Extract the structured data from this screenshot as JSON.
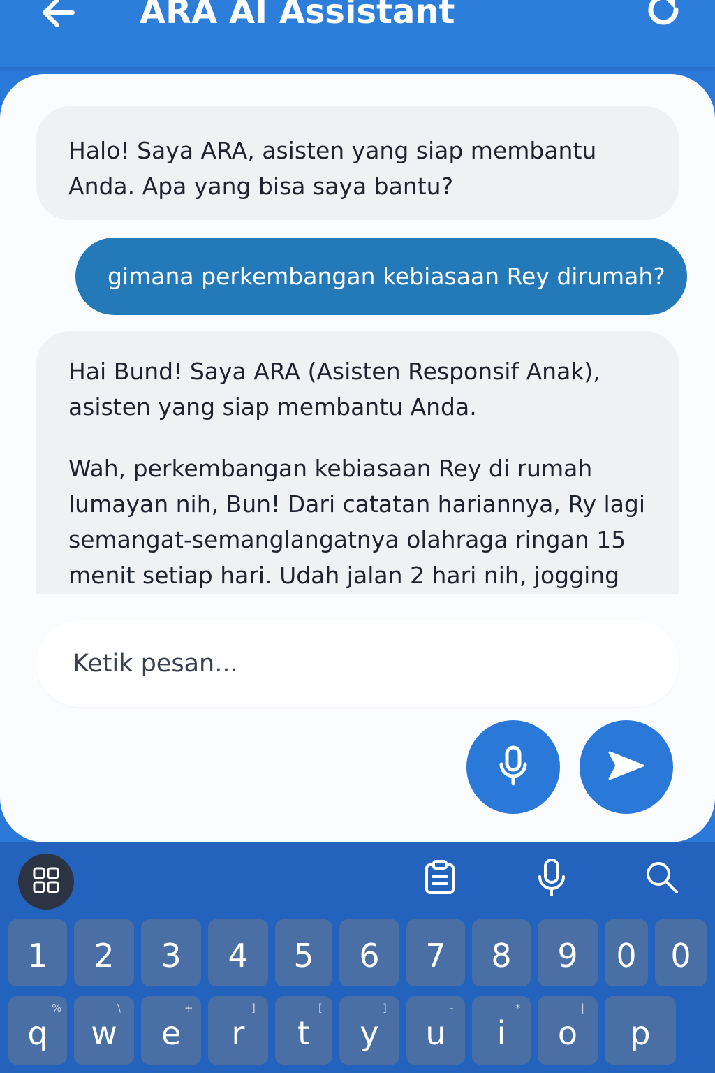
{
  "header": {
    "title": "ARA AI Assistant",
    "back_icon": "arrow-left-icon",
    "refresh_icon": "refresh-icon",
    "color": "#2d7ddb"
  },
  "messages": [
    {
      "role": "assistant",
      "paragraphs": [
        "Halo! Saya ARA, asisten yang siap membantu Anda. Apa yang bisa saya bantu?"
      ]
    },
    {
      "role": "user",
      "text": "gimana perkembangan kebiasaan Rey dirumah?",
      "color": "#2479b8"
    },
    {
      "role": "assistant",
      "paragraphs": [
        "Hai Bund! Saya ARA (Asisten Responsif Anak), asisten yang siap membantu Anda.",
        "Wah, perkembangan kebiasaan Rey di rumah lumayan nih, Bun! Dari catatan hariannya, Ry lagi semangat-semanglangatnya olahraga ringan 15 menit setiap hari. Udah jalan 2 hari nih, jogging"
      ]
    }
  ],
  "composer": {
    "placeholder": "Ketik pesan...",
    "mic_icon": "microphone-icon",
    "send_icon": "send-icon"
  },
  "keyboard": {
    "toolbar": [
      "apps-grid-icon",
      "clipboard-icon",
      "microphone-icon",
      "search-icon"
    ],
    "number_row": [
      "1",
      "2",
      "3",
      "4",
      "5",
      "6",
      "7",
      "8",
      "9",
      "0",
      "0"
    ],
    "letter_row": [
      {
        "key": "q",
        "alt": "%"
      },
      {
        "key": "w",
        "alt": "\\"
      },
      {
        "key": "e",
        "alt": "+"
      },
      {
        "key": "r",
        "alt": "]"
      },
      {
        "key": "t",
        "alt": "["
      },
      {
        "key": "y",
        "alt": "]"
      },
      {
        "key": "u",
        "alt": "-"
      },
      {
        "key": "i",
        "alt": "*"
      },
      {
        "key": "o",
        "alt": "|"
      },
      {
        "key": "p",
        "alt": ""
      }
    ]
  }
}
